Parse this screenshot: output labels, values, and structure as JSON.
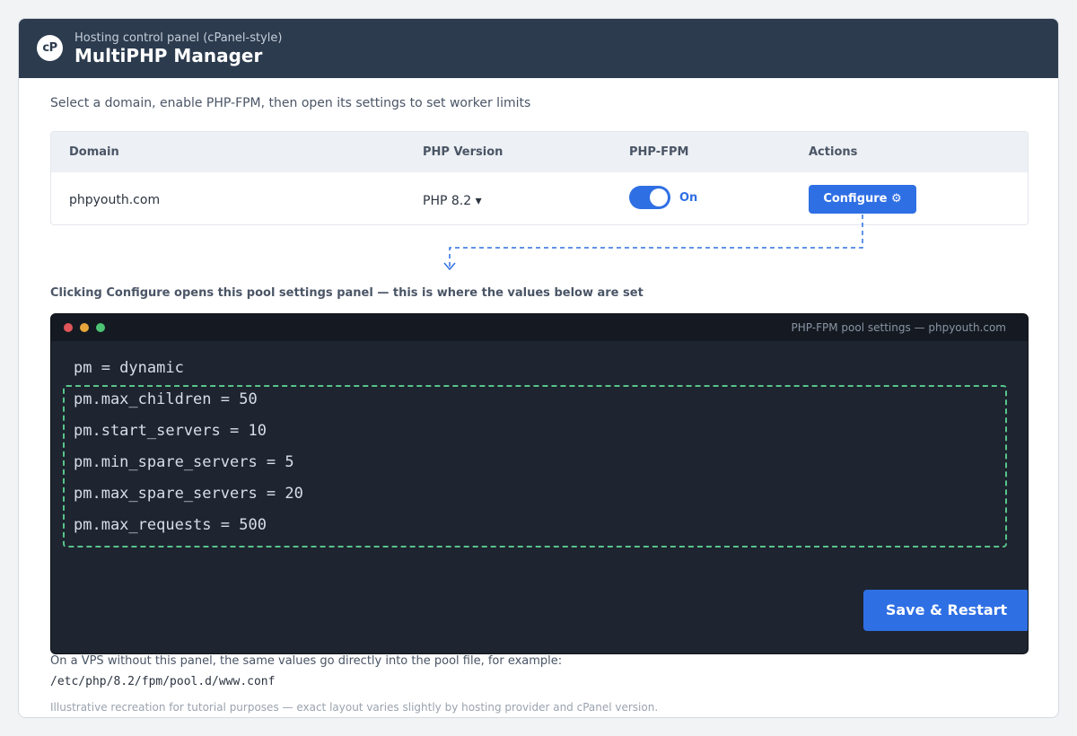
{
  "header": {
    "logo_text": "cP",
    "subtitle": "Hosting control panel (cPanel-style)",
    "title": "MultiPHP Manager"
  },
  "instruction": "Select a domain, enable PHP-FPM, then open its settings to set worker limits",
  "table": {
    "columns": [
      "Domain",
      "PHP Version",
      "PHP-FPM",
      "Actions"
    ],
    "row": {
      "domain": "phpyouth.com",
      "php_version": "PHP 8.2 ▾",
      "fpm_enabled": true,
      "fpm_label": "On",
      "action_label": "Configure ⚙"
    }
  },
  "panel_caption": "Clicking Configure opens this pool settings panel — this is where the values below are set",
  "terminal": {
    "title": "PHP-FPM pool settings — phpyouth.com",
    "lines": [
      "pm = dynamic",
      "pm.max_children = 50",
      "pm.start_servers = 10",
      "pm.min_spare_servers = 5",
      "pm.max_spare_servers = 20",
      "pm.max_requests = 500"
    ],
    "save_label": "Save & Restart"
  },
  "vps_note": "On a VPS without this panel, the same values go directly into the pool file, for example:",
  "vps_path": "/etc/php/8.2/fpm/pool.d/www.conf",
  "footnote": "Illustrative recreation for tutorial purposes — exact layout varies slightly by hosting provider and cPanel version.",
  "colors": {
    "header_bg": "#2c3b4e",
    "accent": "#2f6fe4",
    "highlight_border": "#58c48a",
    "terminal_bg": "#1e2430"
  }
}
